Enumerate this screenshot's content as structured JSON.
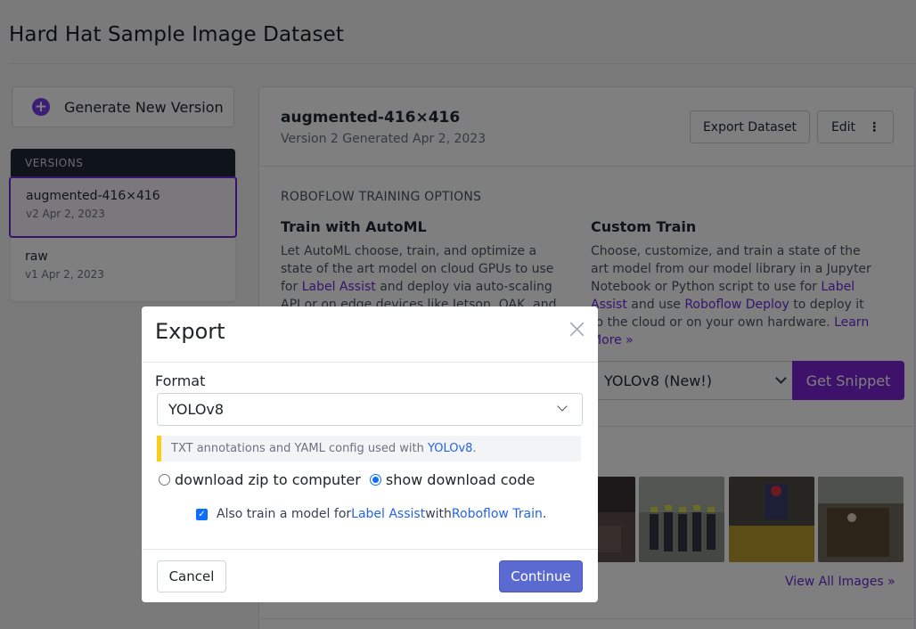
{
  "page": {
    "title": "Hard Hat Sample Image Dataset"
  },
  "sidebar": {
    "generate_label": "Generate New Version",
    "versions_header": "VERSIONS",
    "versions": [
      {
        "name": "augmented-416×416",
        "sub": "v2 Apr 2, 2023",
        "active": true
      },
      {
        "name": "raw",
        "sub": "v1 Apr 2, 2023",
        "active": false
      }
    ]
  },
  "main": {
    "title": "augmented-416×416",
    "subtitle": "Version 2 Generated Apr 2, 2023",
    "export_button": "Export Dataset",
    "edit_button": "Edit",
    "options_label": "ROBOFLOW TRAINING OPTIONS",
    "automl": {
      "title": "Train with AutoML",
      "text_a": "Let AutoML choose, train, and optimize a state of the art model on cloud GPUs to use for ",
      "link_a": "Label Assist",
      "text_b": " and deploy via auto-scaling API or on edge devices like Jetson, OAK, and Raspberry"
    },
    "custom": {
      "title": "Custom Train",
      "text_a": "Choose, customize, and train a state of the art model from our model library in a Jupyter Notebook or Python script to use for ",
      "link_a": "Label Assist",
      "text_b": " and use ",
      "link_b": "Roboflow Deploy",
      "text_c": " to deploy it to the cloud or on your own hardware. ",
      "link_c": "Learn More »"
    },
    "model_select": "YOLOv8 (New!)",
    "snippet_button": "Get Snippet",
    "view_all": "View All Images »"
  },
  "modal": {
    "title": "Export",
    "close_icon": "×",
    "format_label": "Format",
    "format_value": "YOLOv8",
    "hint_text": "TXT annotations and YAML config used with ",
    "hint_link": "YOLOv8",
    "hint_end": ".",
    "radio_zip": "download zip to computer",
    "radio_code": "show download code",
    "selected_option": "show download code",
    "check_text_a": "Also train a model for ",
    "check_link_a": "Label Assist",
    "check_text_b": " with ",
    "check_link_b": "Roboflow Train",
    "check_text_c": ".",
    "check_checked": true,
    "cancel": "Cancel",
    "continue": "Continue"
  },
  "colors": {
    "accent": "#7c22d4",
    "primary_button": "#5b6ad0",
    "hint_bar": "#facc15"
  }
}
